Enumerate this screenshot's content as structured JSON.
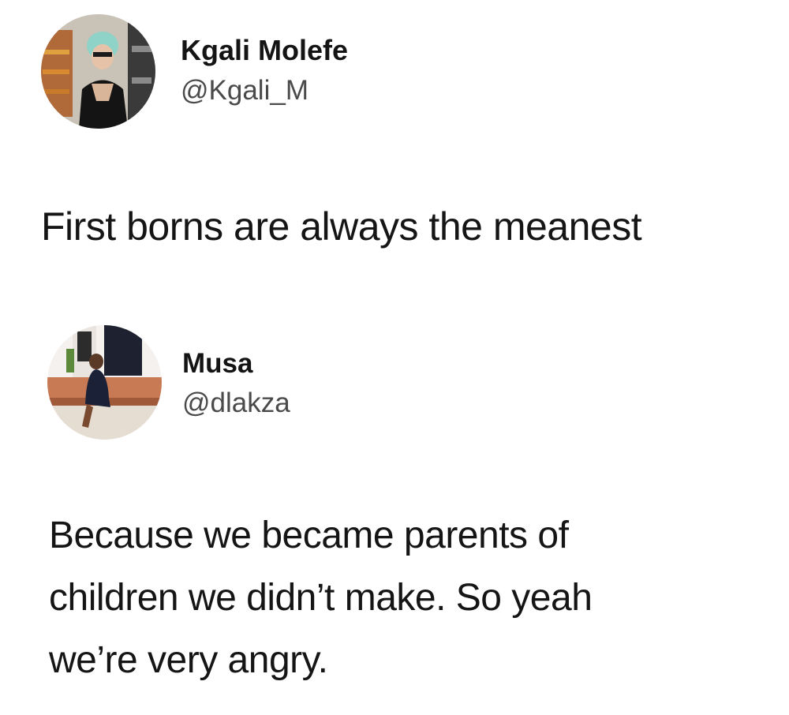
{
  "tweet": {
    "author_name": "Kgali Molefe",
    "author_handle": "@Kgali_M",
    "avatar_icon": "profile-photo-woman-icon",
    "text": "First borns are always the meanest"
  },
  "reply": {
    "author_name": "Musa",
    "author_handle": "@dlakza",
    "avatar_icon": "profile-photo-woman-seated-icon",
    "lines": [
      "Because we became parents of",
      "children we didn’t make. So yeah",
      "we’re very angry."
    ]
  }
}
